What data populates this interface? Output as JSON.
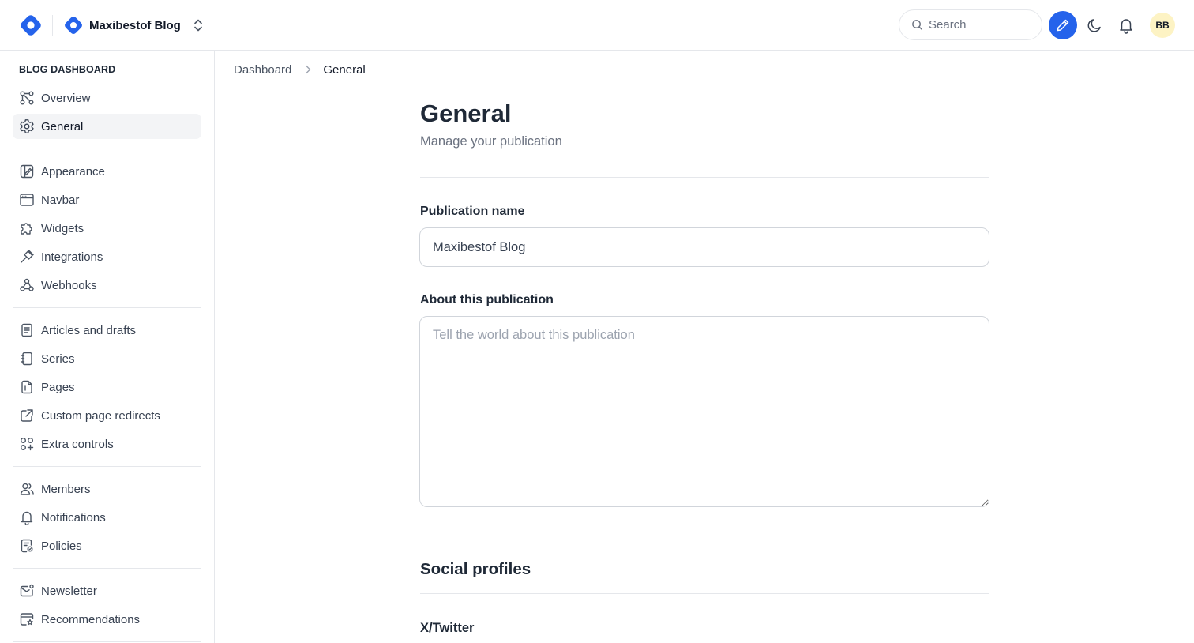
{
  "header": {
    "publication_name": "Maxibestof Blog",
    "search_placeholder": "Search",
    "avatar_initials": "BB",
    "accent_color": "#2563eb"
  },
  "sidebar": {
    "heading": "BLOG DASHBOARD",
    "groups": [
      [
        {
          "label": "Overview",
          "icon": "overview-icon"
        },
        {
          "label": "General",
          "icon": "gear-icon",
          "active": true
        }
      ],
      [
        {
          "label": "Appearance",
          "icon": "appearance-icon"
        },
        {
          "label": "Navbar",
          "icon": "navbar-icon"
        },
        {
          "label": "Widgets",
          "icon": "puzzle-icon"
        },
        {
          "label": "Integrations",
          "icon": "plug-icon"
        },
        {
          "label": "Webhooks",
          "icon": "webhook-icon"
        }
      ],
      [
        {
          "label": "Articles and drafts",
          "icon": "document-icon"
        },
        {
          "label": "Series",
          "icon": "notebook-icon"
        },
        {
          "label": "Pages",
          "icon": "pages-icon"
        },
        {
          "label": "Custom page redirects",
          "icon": "external-link-icon"
        },
        {
          "label": "Extra controls",
          "icon": "controls-icon"
        }
      ],
      [
        {
          "label": "Members",
          "icon": "users-icon"
        },
        {
          "label": "Notifications",
          "icon": "bell-icon"
        },
        {
          "label": "Policies",
          "icon": "policy-icon"
        }
      ],
      [
        {
          "label": "Newsletter",
          "icon": "mail-icon"
        },
        {
          "label": "Recommendations",
          "icon": "recommendations-icon"
        }
      ]
    ]
  },
  "breadcrumb": {
    "parent": "Dashboard",
    "current": "General"
  },
  "main": {
    "title": "General",
    "subtitle": "Manage your publication",
    "publication_name_label": "Publication name",
    "publication_name_value": "Maxibestof Blog",
    "about_label": "About this publication",
    "about_placeholder": "Tell the world about this publication",
    "social_title": "Social profiles",
    "twitter_label": "X/Twitter"
  }
}
